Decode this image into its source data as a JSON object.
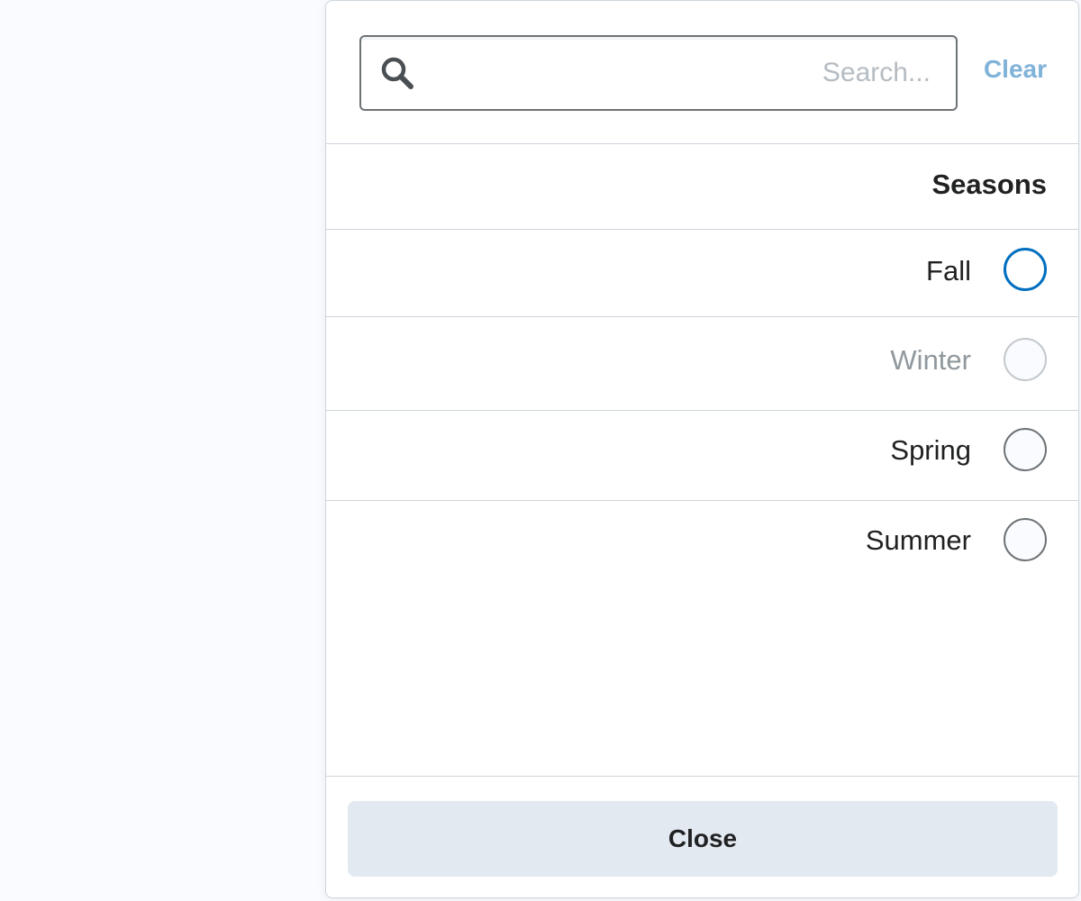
{
  "search": {
    "placeholder": "...Search",
    "value": "",
    "clear_label": "Clear",
    "icon": "search-icon"
  },
  "section": {
    "title": "Seasons"
  },
  "options": [
    {
      "label": "Fall",
      "state": "focused"
    },
    {
      "label": "Winter",
      "state": "disabled"
    },
    {
      "label": "Spring",
      "state": "normal"
    },
    {
      "label": "Summer",
      "state": "normal"
    }
  ],
  "footer": {
    "close_label": "Close"
  },
  "colors": {
    "accent": "#006fbf",
    "clear_link": "#7fb3d8",
    "button_bg": "#e3e9f1",
    "divider": "#cdd5dc"
  }
}
